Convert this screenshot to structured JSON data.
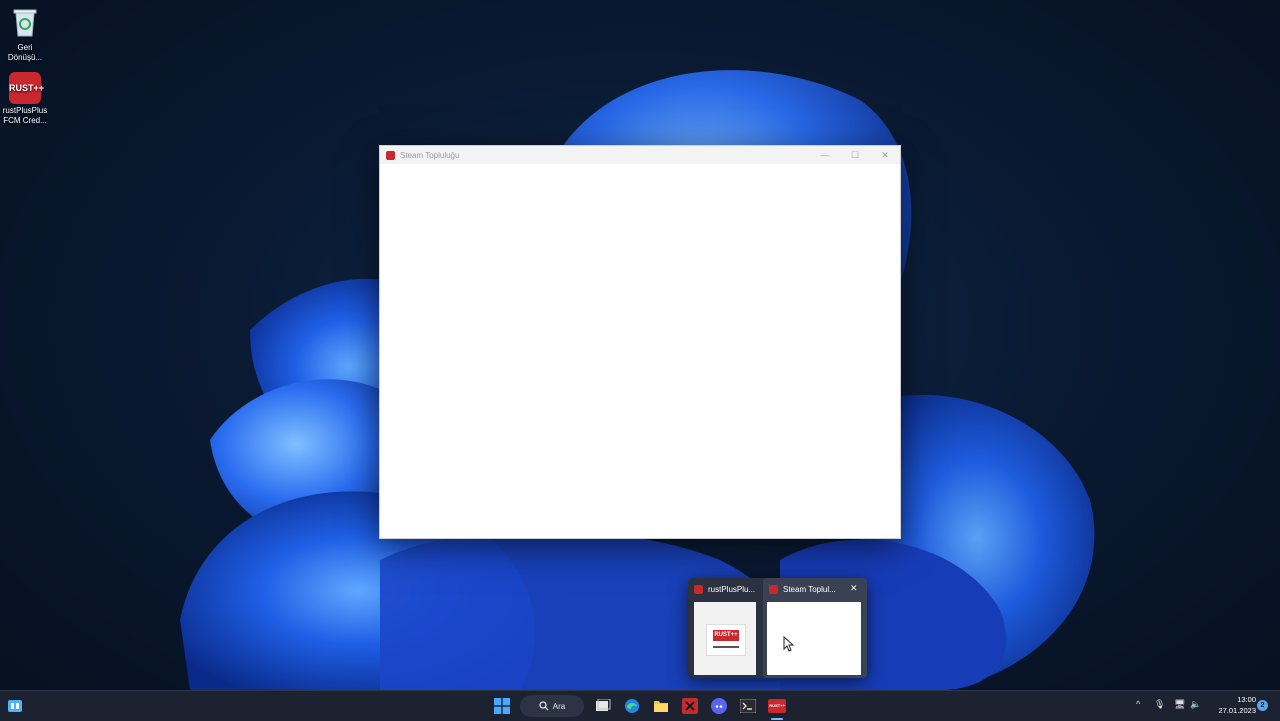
{
  "desktop": {
    "icons": [
      {
        "label": "Geri\nDönüşü...",
        "icon": "recycle-bin-icon"
      },
      {
        "label": "rustPlusPlus\nFCM Cred...",
        "icon": "rustplusplus-icon",
        "badge": "RUST++"
      }
    ]
  },
  "window": {
    "title": "Steam Topluluğu",
    "controls": {
      "minimize": "—",
      "maximize": "☐",
      "close": "✕"
    }
  },
  "taskbar_preview": {
    "items": [
      {
        "title": "rustPlusPlu...",
        "preview_badge": "RUST++"
      },
      {
        "title": "Steam Toplul...",
        "close": "✕"
      }
    ]
  },
  "taskbar": {
    "search_label": "Ara",
    "pinned": [
      "task-view-icon",
      "edge-icon",
      "file-explorer-icon",
      "rust-app-icon",
      "discord-icon",
      "terminal-icon",
      "rustplusplus-icon"
    ],
    "pinned_badge": "RUST++",
    "tray": {
      "chevron": "^",
      "mic": "🎙",
      "network": "🖥",
      "volume": "🔈"
    },
    "time": "13:00",
    "date": "27.01.2023",
    "notification_count": "2"
  }
}
